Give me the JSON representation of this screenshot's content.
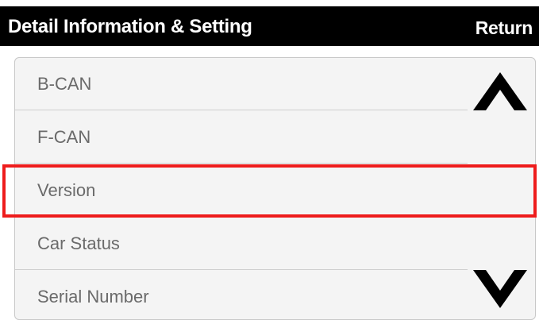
{
  "header": {
    "title": "Detail Information & Setting",
    "return_label": "Return"
  },
  "list": {
    "items": [
      {
        "label": "B-CAN"
      },
      {
        "label": "F-CAN"
      },
      {
        "label": "Version"
      },
      {
        "label": "Car Status"
      },
      {
        "label": "Serial Number"
      }
    ],
    "highlighted_item": "Version"
  },
  "scroll": {
    "up_icon": "chevron-up-icon",
    "down_icon": "chevron-down-icon"
  },
  "colors": {
    "header_bg": "#000000",
    "header_text": "#ffffff",
    "list_bg": "#f4f4f4",
    "item_text": "#6a6a6a",
    "highlight": "#ee1c1c"
  }
}
